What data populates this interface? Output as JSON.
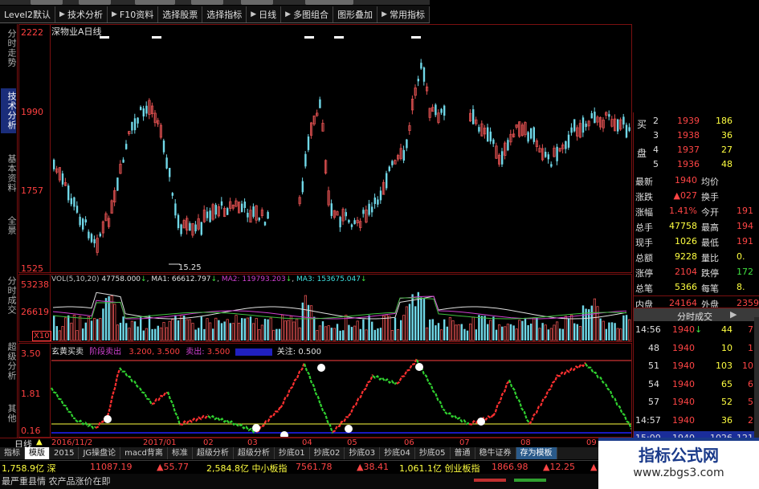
{
  "toolbar": {
    "items": [
      "Level2默认",
      "技术分析",
      "F10资料",
      "选择股票",
      "选择指标",
      "日线",
      "多图组合",
      "图形叠加",
      "常用指标"
    ]
  },
  "left_tabs": [
    "分时走势",
    "技术分析",
    "基本资料",
    "全景"
  ],
  "left_tabs_lower": [
    "分时成交",
    "超级分析",
    "其他"
  ],
  "price_panel": {
    "title": "深物业A日线",
    "y_labels": [
      "2222",
      "1990",
      "1757",
      "1525"
    ],
    "low_label": "15.25"
  },
  "vol_panel": {
    "label": "VOL(5,10,20)",
    "vol": "47758.000",
    "ma1": "MA1: 66612.797",
    "ma2": "MA2: 119793.203",
    "ma3": "MA3: 153675.047",
    "y_labels": [
      "53238",
      "26619"
    ],
    "x10": "X10"
  },
  "ind_panel": {
    "name": "玄黄买卖",
    "label1": "阶段卖出",
    "v1": "3.200",
    "v2": "3.500",
    "label2": "卖出",
    "v3": "3.500",
    "label3": "关注",
    "v4": "0.500",
    "y_labels": [
      "3.50",
      "1.81",
      "0.16"
    ]
  },
  "dates": {
    "period": "日线",
    "labels": [
      "2016/11/2",
      "2017/01",
      "02",
      "03",
      "04",
      "05",
      "06",
      "07",
      "08",
      "09"
    ]
  },
  "bottom_tabs": [
    "指标",
    "模版",
    "2015",
    "JG操盘论",
    "macd背离",
    "标准",
    "超级分析",
    "超级分析",
    "抄底01",
    "抄底02",
    "抄底03",
    "抄底04",
    "抄底05",
    "普通",
    "稳牛证券",
    "存为模板"
  ],
  "index_bar": [
    {
      "text": "1,758.9亿 深",
      "color": "yellow"
    },
    {
      "text": "11087.19",
      "color": "red"
    },
    {
      "text": "▲55.77",
      "color": "red"
    },
    {
      "text": "2,584.8亿 中小板指",
      "color": "yellow"
    },
    {
      "text": "7561.78",
      "color": "red"
    },
    {
      "text": "▲38.41",
      "color": "red"
    },
    {
      "text": "1,061.1亿 创业板指",
      "color": "yellow"
    },
    {
      "text": "1866.98",
      "color": "red"
    },
    {
      "text": "▲12.25",
      "color": "red"
    },
    {
      "text": "▲",
      "color": "red"
    }
  ],
  "news": "最严重县情 农产品涨价在即",
  "quote": {
    "bid_label": "买",
    "bid_label2": "盘",
    "bids": [
      {
        "n": "2",
        "price": "1939",
        "vol": "186"
      },
      {
        "n": "3",
        "price": "1938",
        "vol": "36"
      },
      {
        "n": "4",
        "price": "1937",
        "vol": "27"
      },
      {
        "n": "5",
        "price": "1936",
        "vol": "48"
      }
    ],
    "stats": [
      {
        "l1": "最新",
        "v1": "1940",
        "l2": "均价",
        "v2": ""
      },
      {
        "l1": "涨跌",
        "v1": "▲027",
        "l2": "换手",
        "v2": ""
      },
      {
        "l1": "涨幅",
        "v1": "1.41%",
        "l2": "今开",
        "v2": "191"
      },
      {
        "l1": "总手",
        "v1": "47758",
        "l2": "最高",
        "v2": "194"
      },
      {
        "l1": "现手",
        "v1": "1026",
        "l2": "最低",
        "v2": "191"
      },
      {
        "l1": "总额",
        "v1": "9228",
        "l2": "量比",
        "v2": "0."
      },
      {
        "l1": "涨停",
        "v1": "2104",
        "l2": "跌停",
        "v2": "172"
      },
      {
        "l1": "总笔",
        "v1": "5366",
        "l2": "每笔",
        "v2": "8."
      },
      {
        "l1": "内盘",
        "v1": "24164",
        "l2": "外盘",
        "v2": "2359"
      }
    ],
    "trades_header": "分时成交",
    "trades": [
      {
        "t": "14:56",
        "p": "1940",
        "arrow": "↓",
        "v": "44",
        "n": "7"
      },
      {
        "t": "48",
        "p": "1940",
        "arrow": "",
        "v": "10",
        "n": "1"
      },
      {
        "t": "51",
        "p": "1940",
        "arrow": "",
        "v": "103",
        "n": "10"
      },
      {
        "t": "54",
        "p": "1940",
        "arrow": "",
        "v": "65",
        "n": "6"
      },
      {
        "t": "57",
        "p": "1940",
        "arrow": "",
        "v": "52",
        "n": "5"
      },
      {
        "t": "14:57",
        "p": "1940",
        "arrow": "",
        "v": "36",
        "n": "2"
      },
      {
        "t": "15:00",
        "p": "1940",
        "arrow": "",
        "v": "1026",
        "n": "121"
      }
    ]
  },
  "watermark": {
    "title": "指标公式网",
    "url": "www.zbgs3.com"
  }
}
